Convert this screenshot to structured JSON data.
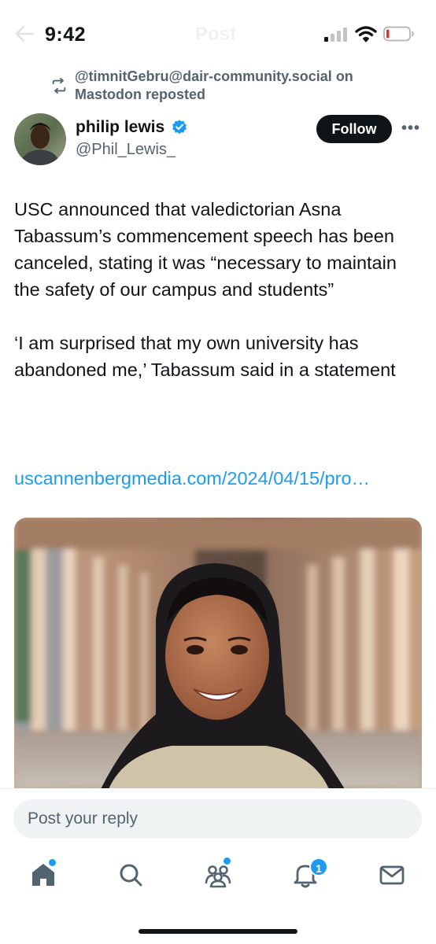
{
  "status_bar": {
    "time": "9:42",
    "header_title_faded": "Post",
    "battery_color": "#e0312f"
  },
  "repost": {
    "text": "@timnitGebru@dair-community.social on Mastodon reposted",
    "icon": "repost-icon"
  },
  "author": {
    "name": "philip lewis",
    "handle": "@Phil_Lewis_",
    "verified": true,
    "follow_label": "Follow",
    "more_label": "•••"
  },
  "tweet": {
    "paragraph_1": "USC announced that valedictorian Asna Tabassum’s commencement speech has been canceled, stating it was “necessary to maintain the safety of our campus and students”",
    "paragraph_2": "‘I am surprised that my own university has abandoned me,’ Tabassum said in a statement",
    "link": "uscannenbergmedia.com/2024/04/15/pro…"
  },
  "reply": {
    "placeholder": "Post your reply"
  },
  "tab_bar": {
    "items": [
      {
        "name": "home-icon",
        "has_dot": true
      },
      {
        "name": "search-icon",
        "has_dot": false
      },
      {
        "name": "communities-icon",
        "has_dot": true
      },
      {
        "name": "notifications-icon",
        "badge": "1"
      },
      {
        "name": "messages-icon",
        "has_dot": false
      }
    ]
  },
  "colors": {
    "accent": "#1d9bf0",
    "text": "#0f1419",
    "secondary": "#536471"
  }
}
